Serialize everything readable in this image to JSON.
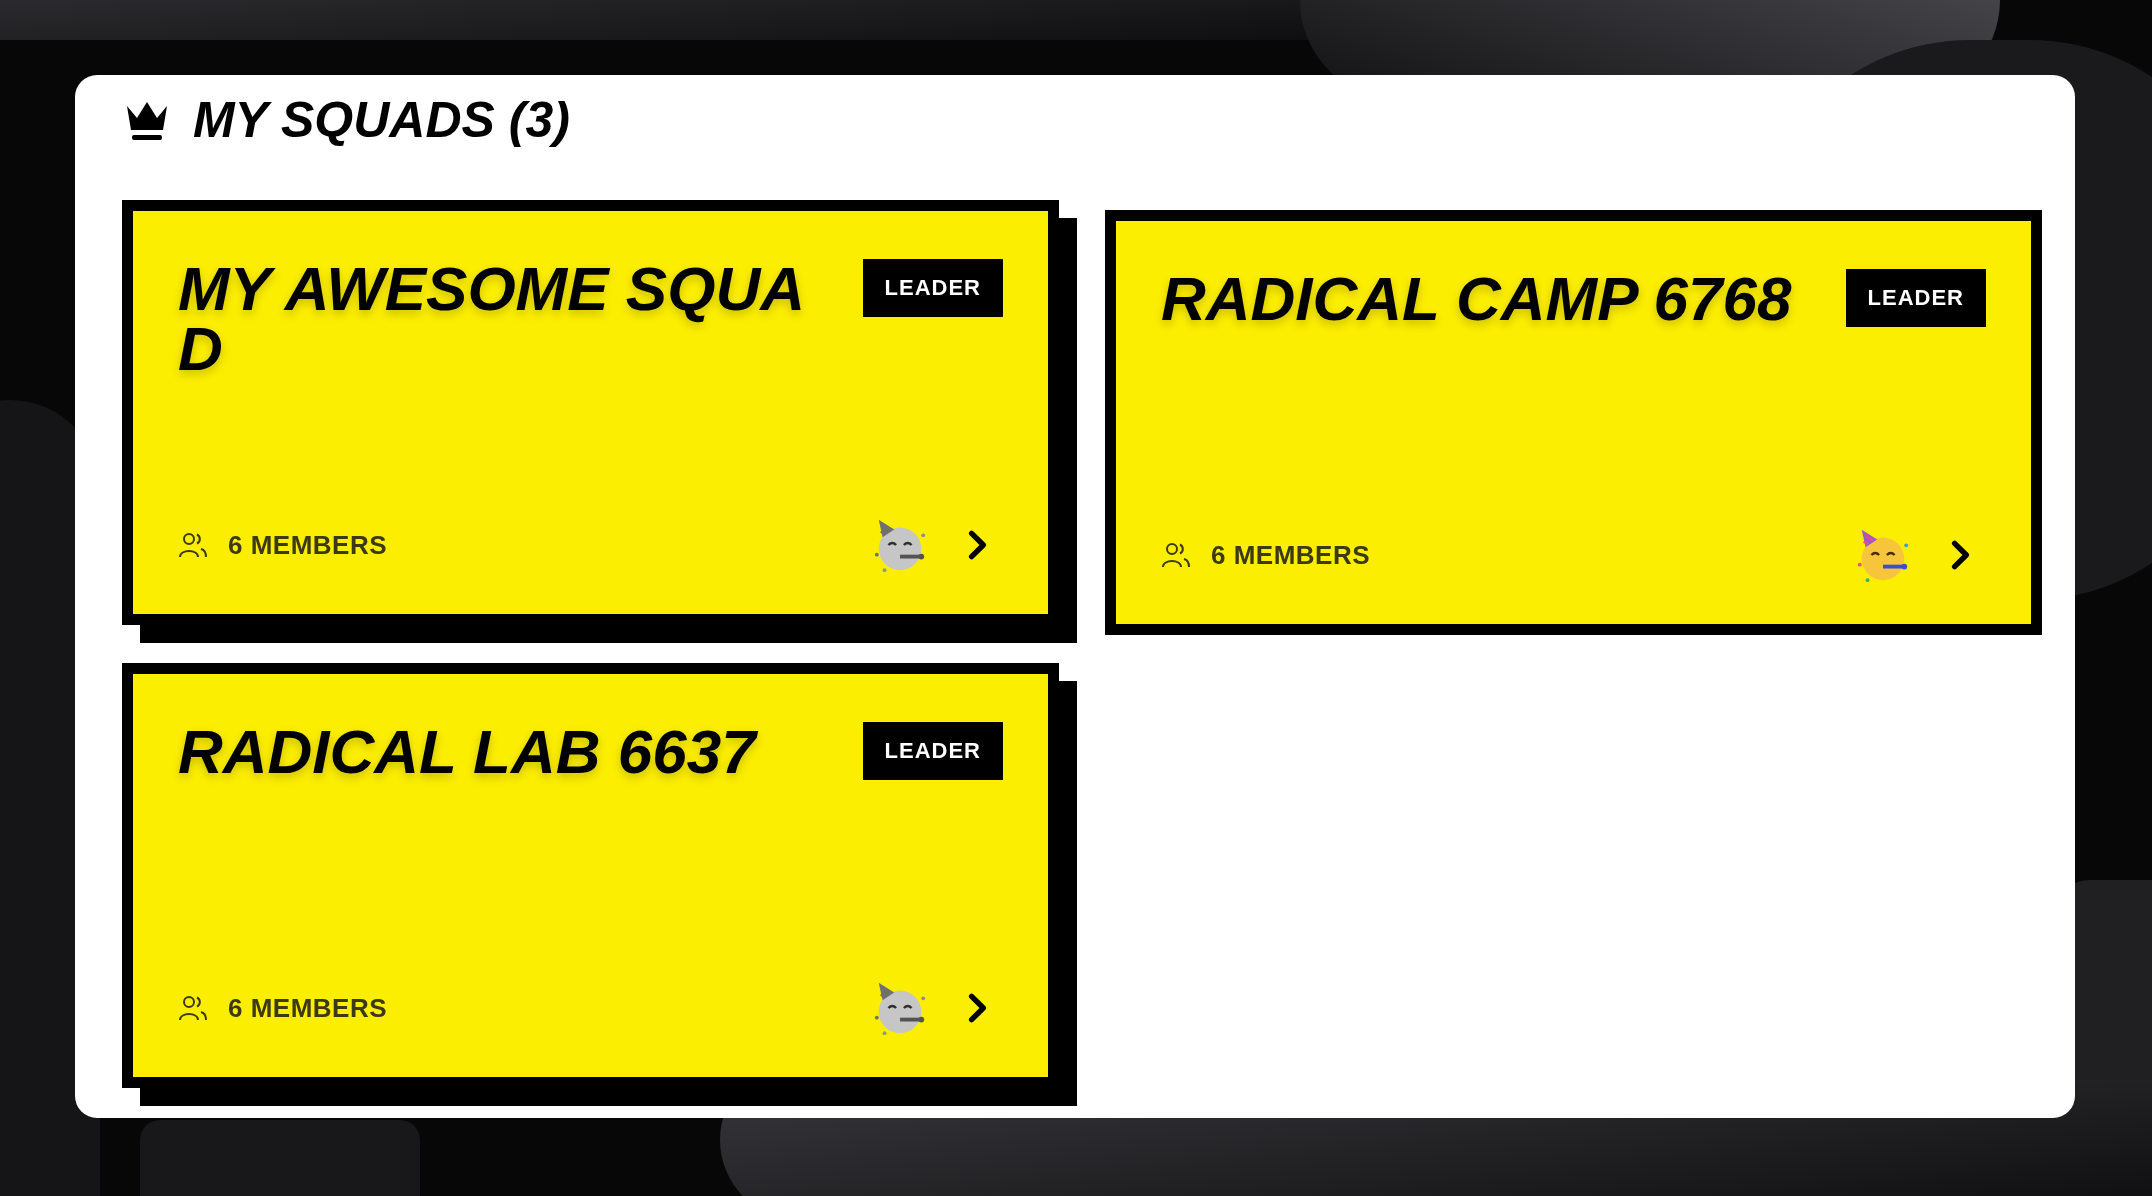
{
  "header": {
    "title": "MY SQUADS (3)"
  },
  "squads": [
    {
      "name": "MY AWESOME SQUAD",
      "badge": "LEADER",
      "members": "6 MEMBERS",
      "raised": true
    },
    {
      "name": "RADICAL CAMP 6768",
      "badge": "LEADER",
      "members": "6 MEMBERS",
      "raised": false
    },
    {
      "name": "RADICAL LAB 6637",
      "badge": "LEADER",
      "members": "6 MEMBERS",
      "raised": true
    }
  ]
}
